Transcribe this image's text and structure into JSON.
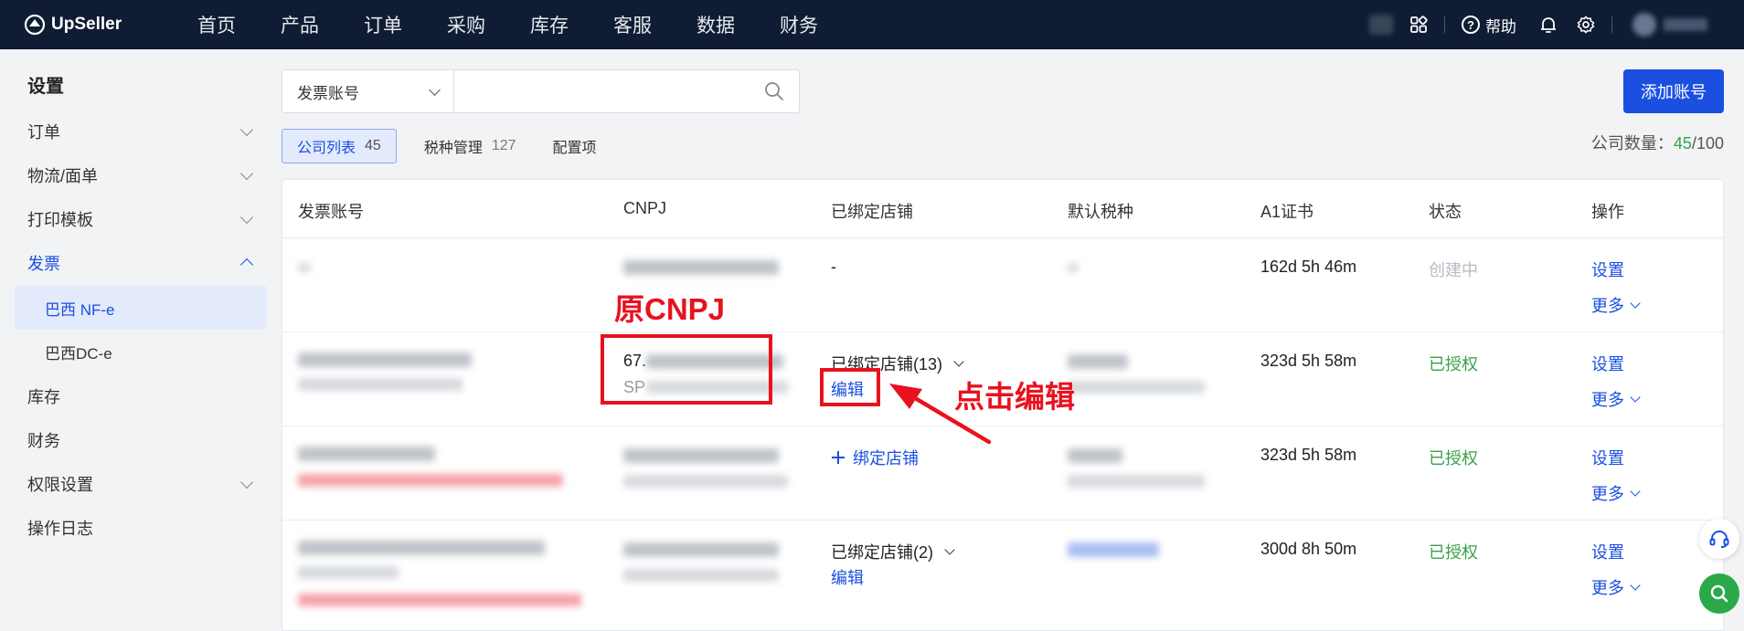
{
  "topbar": {
    "brand": "UpSeller",
    "nav": [
      "首页",
      "产品",
      "订单",
      "采购",
      "库存",
      "客服",
      "数据",
      "财务"
    ],
    "help_label": "帮助"
  },
  "sidebar": {
    "title": "设置",
    "items": [
      {
        "label": "订单",
        "expandable": true
      },
      {
        "label": "物流/面单",
        "expandable": true
      },
      {
        "label": "打印模板",
        "expandable": true
      },
      {
        "label": "发票",
        "expandable": true,
        "open": true
      },
      {
        "label": "库存",
        "expandable": false
      },
      {
        "label": "财务",
        "expandable": false
      },
      {
        "label": "权限设置",
        "expandable": true
      },
      {
        "label": "操作日志",
        "expandable": false
      }
    ],
    "sub_items": [
      {
        "label": "巴西 NF-e",
        "active": true
      },
      {
        "label": "巴西DC-e",
        "active": false
      }
    ]
  },
  "search": {
    "select_value": "发票账号",
    "placeholder": ""
  },
  "add_button_label": "添加账号",
  "tabs": [
    {
      "label": "公司列表",
      "count": "45",
      "active": true
    },
    {
      "label": "税种管理",
      "count": "127",
      "active": false
    },
    {
      "label": "配置项",
      "count": "",
      "active": false
    }
  ],
  "company_count": {
    "label": "公司数量：",
    "used": "45",
    "total": "/100"
  },
  "table": {
    "headers": [
      "发票账号",
      "CNPJ",
      "已绑定店铺",
      "默认税种",
      "A1证书",
      "状态",
      "操作"
    ],
    "rows": [
      {
        "cnpj_visible": "",
        "bound_store": "-",
        "bound_action": "",
        "cert": "162d 5h 46m",
        "status": "创建中",
        "status_type": "grey",
        "op_setting": "设置",
        "op_more": "更多"
      },
      {
        "cnpj_visible": "67.",
        "cnpj_sub_visible": "SP",
        "bound_store": "已绑定店铺(13)",
        "bound_action": "编辑",
        "cert": "323d 5h 58m",
        "status": "已授权",
        "status_type": "green",
        "op_setting": "设置",
        "op_more": "更多"
      },
      {
        "cnpj_visible": "",
        "bound_store": "",
        "bound_action": "绑定店铺",
        "cert": "323d 5h 58m",
        "status": "已授权",
        "status_type": "green",
        "op_setting": "设置",
        "op_more": "更多"
      },
      {
        "cnpj_visible": "",
        "bound_store": "已绑定店铺(2)",
        "bound_action": "编辑",
        "cert": "300d 8h 50m",
        "status": "已授权",
        "status_type": "green",
        "op_setting": "设置",
        "op_more": "更多"
      }
    ]
  },
  "annotations": {
    "original_cnpj": "原CNPJ",
    "click_edit": "点击编辑"
  },
  "colors": {
    "topbar_bg": "#0f1c33",
    "accent": "#1a4fe0",
    "success": "#3aa14a",
    "annotation_red": "#e8121f"
  }
}
